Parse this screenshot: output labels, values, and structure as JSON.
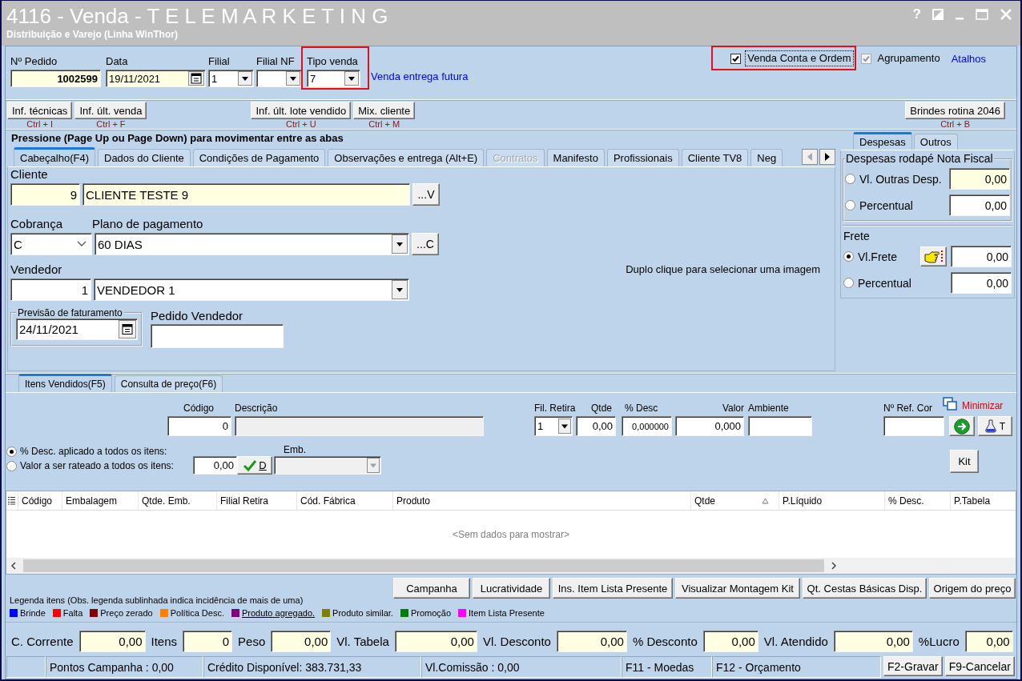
{
  "window": {
    "title": "4116 - Venda - T E L E M A R K E T I N G",
    "subtitle": "Distribuição e Varejo (Linha WinThor)",
    "help": "?"
  },
  "header": {
    "fields": [
      {
        "kind": "text",
        "label": "Nº Pedido",
        "value": "1002599",
        "tinted": true,
        "highlighted": false
      },
      {
        "kind": "date",
        "label": "Data",
        "value": "19/11/2021",
        "tinted": true,
        "highlighted": false
      },
      {
        "kind": "combo",
        "label": "Filial",
        "value": "1",
        "tinted": false,
        "highlighted": false
      },
      {
        "kind": "combo",
        "label": "Filial NF",
        "tinted": false,
        "highlighted": false
      },
      {
        "kind": "combo",
        "label": "Tipo venda",
        "value": "7",
        "tinted": false,
        "highlighted": true
      }
    ],
    "sale_type_note": "Venda entrega futura",
    "options": [
      {
        "label": "Venda Conta e Ordem",
        "checked": true,
        "disabled": false,
        "focused": true,
        "highlighted": true
      },
      {
        "label": "Agrupamento",
        "checked": true,
        "disabled": true,
        "focused": false,
        "highlighted": false
      }
    ],
    "shortcuts_link": "Atalhos"
  },
  "quick_buttons": [
    {
      "buttons": [
        {
          "label": "Inf. técnicas",
          "shortcut": "Ctrl + I"
        },
        {
          "label": "Inf. últ. venda",
          "shortcut": "Ctrl + F"
        }
      ]
    },
    {
      "buttons": [
        {
          "label": "Inf. últ. lote vendido",
          "shortcut": "Ctrl + U"
        },
        {
          "label": "Mix. cliente",
          "shortcut": "Ctrl + M"
        }
      ]
    },
    {
      "buttons": [
        {
          "label": "Brindes rotina 2046",
          "shortcut": "Ctrl + B"
        }
      ]
    }
  ],
  "main_tabs": {
    "hint": "Pressione (Page Up ou Page Down) para movimentar entre as abas",
    "tabs": [
      {
        "label": "Cabeçalho(F4)",
        "selected": true,
        "disabled": false
      },
      {
        "label": "Dados do Cliente",
        "selected": false,
        "disabled": false
      },
      {
        "label": "Condições de Pagamento",
        "selected": false,
        "disabled": false
      },
      {
        "label": "Observações e entrega (Alt+E)",
        "selected": false,
        "disabled": false
      },
      {
        "label": "Contratos",
        "selected": false,
        "disabled": true
      },
      {
        "label": "Manifesto",
        "selected": false,
        "disabled": false
      },
      {
        "label": "Profissionais",
        "selected": false,
        "disabled": false
      },
      {
        "label": "Cliente TV8",
        "selected": false,
        "disabled": false
      },
      {
        "label": "Neg",
        "selected": false,
        "disabled": false
      }
    ]
  },
  "header_tab": {
    "client": {
      "label": "Cliente",
      "code": "9",
      "name": "CLIENTE TESTE 9",
      "button": "...V"
    },
    "billing": {
      "label": "Cobrança",
      "value": "C"
    },
    "payment_plan": {
      "label": "Plano de pagamento",
      "value": "60 DIAS",
      "button": "...C"
    },
    "seller": {
      "label": "Vendedor",
      "code": "1",
      "name": "VENDEDOR 1"
    },
    "billing_forecast": {
      "label": "Previsão de faturamento",
      "value": "24/11/2021"
    },
    "seller_order": {
      "label": "Pedido Vendedor"
    },
    "image_hint": "Duplo clique para selecionar uma imagem"
  },
  "expenses": {
    "tabs": [
      {
        "label": "Despesas",
        "selected": true
      },
      {
        "label": "Outros",
        "selected": false
      }
    ],
    "groups": [
      {
        "kind": "framed",
        "title": "Despesas rodapé Nota Fiscal",
        "rows": [
          {
            "kind": "plain",
            "label": "Vl. Outras Desp.",
            "value": "0,00",
            "selected": false,
            "tinted": true
          },
          {
            "kind": "plain",
            "label": "Percentual",
            "value": "0,00",
            "selected": false,
            "tinted": false
          }
        ]
      },
      {
        "kind": "plain",
        "title": "Frete",
        "rows": [
          {
            "kind": "hand_button",
            "label": "Vl.Frete",
            "value": "0,00",
            "selected": true,
            "tinted": false
          },
          {
            "kind": "plain",
            "label": "Percentual",
            "value": "0,00",
            "selected": false,
            "tinted": false
          }
        ]
      }
    ]
  },
  "item_tabs": [
    {
      "label": "Itens Vendidos(F5)",
      "selected": true
    },
    {
      "label": "Consulta de preço(F6)",
      "selected": false
    }
  ],
  "item_entry": {
    "fields": [
      {
        "kind": "text",
        "label": "Código",
        "value": "0",
        "disabled": false
      },
      {
        "kind": "text",
        "label": "Descrição",
        "disabled": true
      },
      {
        "kind": "combo",
        "label": "Fil. Retira",
        "value": "1",
        "disabled": false
      },
      {
        "kind": "text",
        "label": "Qtde",
        "value": "0,00",
        "disabled": false
      },
      {
        "kind": "small",
        "label": "% Desc",
        "value": "0,000000",
        "disabled": false
      },
      {
        "kind": "text",
        "label": "Valor",
        "value": "0,000",
        "disabled": false
      },
      {
        "kind": "text",
        "label": "Ambiente",
        "disabled": false
      },
      {
        "kind": "text",
        "label": "Nº Ref. Cor",
        "disabled": false
      }
    ],
    "minimize_link": "Minimizar",
    "flask_button": "T",
    "discount_modes": [
      {
        "label": "% Desc. aplicado a todos os itens:",
        "selected": true
      },
      {
        "label": "Valor a ser rateado a todos os itens:",
        "selected": false
      }
    ],
    "spread_value": "0,00",
    "apply_button": "D",
    "packaging": {
      "label": "Emb.",
      "disabled": true
    },
    "kit_button": "Kit"
  },
  "table": {
    "columns": [
      {
        "label": "Código",
        "sorted": false
      },
      {
        "label": "Embalagem",
        "sorted": false
      },
      {
        "label": "Qtde. Emb.",
        "sorted": false
      },
      {
        "label": "Filial Retira",
        "sorted": false
      },
      {
        "label": "Cód. Fábrica",
        "sorted": false
      },
      {
        "label": "Produto",
        "sorted": false
      },
      {
        "label": "Qtde",
        "sorted": true
      },
      {
        "label": "P.Líquido",
        "sorted": false
      },
      {
        "label": "% Desc.",
        "sorted": false
      },
      {
        "label": "P.Tabela",
        "sorted": false
      }
    ],
    "empty_text": "<Sem dados para mostrar>"
  },
  "actions": [
    "Campanha",
    "Lucratividade",
    "Ins. Item Lista Presente",
    "Visualizar Montagem Kit",
    "Qt. Cestas Básicas Disp.",
    "Origem do preço"
  ],
  "legend": {
    "title": "Legenda itens (Obs. legenda sublinhada indica incidência de mais de uma)",
    "items": [
      {
        "label": "Brinde",
        "color": "#0000ff",
        "underlined": false
      },
      {
        "label": "Falta",
        "color": "#ff0000",
        "underlined": false
      },
      {
        "label": "Preço zerado",
        "color": "#800000",
        "underlined": false
      },
      {
        "label": "Política Desc.",
        "color": "#ff8000",
        "underlined": false
      },
      {
        "label": "Produto agregado.",
        "color": "#800080",
        "underlined": true
      },
      {
        "label": "Produto similar.",
        "color": "#808000",
        "underlined": false
      },
      {
        "label": "Promoção",
        "color": "#008000",
        "underlined": false
      },
      {
        "label": "Item Lista Presente",
        "color": "#ff00ff",
        "underlined": false
      }
    ]
  },
  "totals": [
    {
      "label": "C. Corrente",
      "value": "0,00"
    },
    {
      "label": "Itens",
      "value": "0"
    },
    {
      "label": "Peso",
      "value": "0,00"
    },
    {
      "label": "Vl. Tabela",
      "value": "0,00"
    },
    {
      "label": "Vl. Desconto",
      "value": "0,00"
    },
    {
      "label": "% Desconto",
      "value": "0,00"
    },
    {
      "label": "Vl. Atendido",
      "value": "0,00"
    },
    {
      "label": "%Lucro",
      "value": "0,00"
    }
  ],
  "status_bar": {
    "panels": [
      "Pontos Campanha : 0,00",
      "Crédito Disponível: 383.731,33",
      "Vl.Comissão : 0,00",
      "F11 - Moedas",
      "F12 - Orçamento"
    ],
    "buttons": [
      "F2-Gravar",
      "F9-Cancelar"
    ]
  }
}
